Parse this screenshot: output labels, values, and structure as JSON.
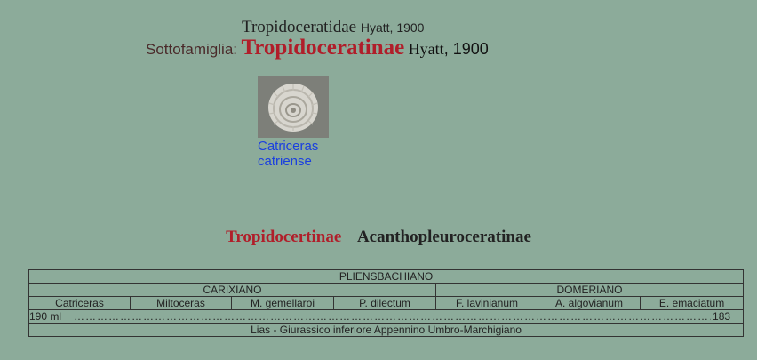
{
  "header": {
    "family": "Tropidoceratidae",
    "family_author": "Hyatt, 1900",
    "subfamily_label": "Sottofamiglia:",
    "subfamily_name": "Tropidoceratinae",
    "subfamily_author_name": "Hyatt",
    "subfamily_author_year": ", 1900"
  },
  "specimen": {
    "caption_line1": "Catriceras",
    "caption_line2": "catriense"
  },
  "nav": {
    "current": "Tropidocertinae",
    "other": "Acanthopleuroceratinae"
  },
  "stratigraphy": {
    "stage": "PLIENSBACHIANO",
    "substage_1": "CARIXIANO",
    "substage_2": "DOMERIANO",
    "zones": [
      "Catriceras",
      "Miltoceras",
      "M. gemellaroi",
      "P. dilectum",
      "F. lavinianum",
      "A. algovianum",
      "E. emaciatum"
    ],
    "range_start": "190 ml",
    "range_end": "183",
    "formation": "Lias - Giurassico inferiore Appennino Umbro-Marchigiano"
  }
}
